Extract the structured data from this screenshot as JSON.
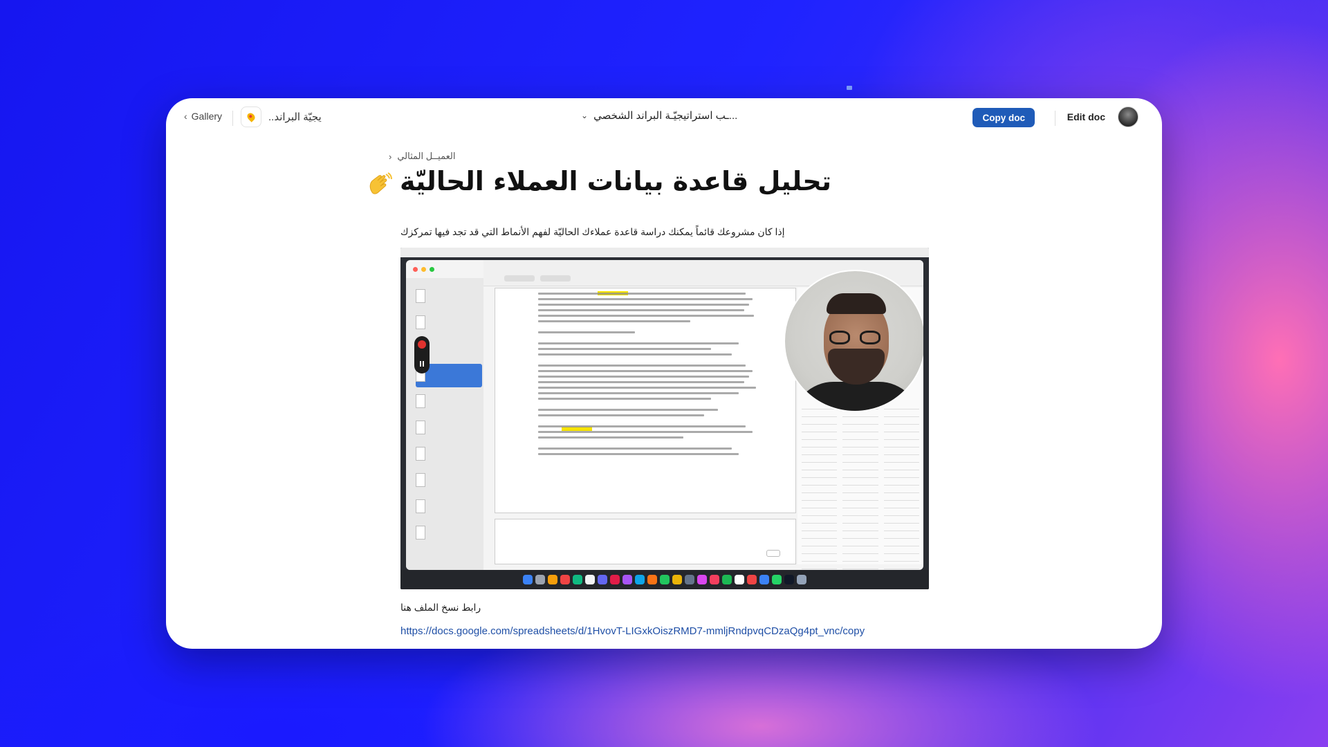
{
  "topbar": {
    "gallery_label": "Gallery",
    "doc_chip_label": "..يجيّة البراند",
    "doc_title": "...ـب استراتيجيّـة البراند الشخصي",
    "copy_label": "Copy doc",
    "edit_label": "Edit doc"
  },
  "page": {
    "breadcrumb": "العميــل المثالي",
    "title": "تحليل قاعدة بيانات العملاء الحاليّة",
    "intro": "إذا كان مشروعك قائماً يمكنك دراسة قاعدة عملاءك الحاليّة لفهم الأنماط التي قد تجد فيها تمركزك",
    "copy_label": "رابط نسخ الملف هنا",
    "link": "https://docs.google.com/spreadsheets/d/1HvovT-LIGxkOiszRMD7-mmljRndpvqCDzaQg4pt_vnc/copy"
  },
  "icons": {
    "wave": "waving-hand-icon",
    "back": "chevron-left-icon",
    "dropdown": "chevron-down-icon"
  },
  "colors": {
    "accent": "#1f5bb8",
    "link": "#1f4fa6"
  }
}
